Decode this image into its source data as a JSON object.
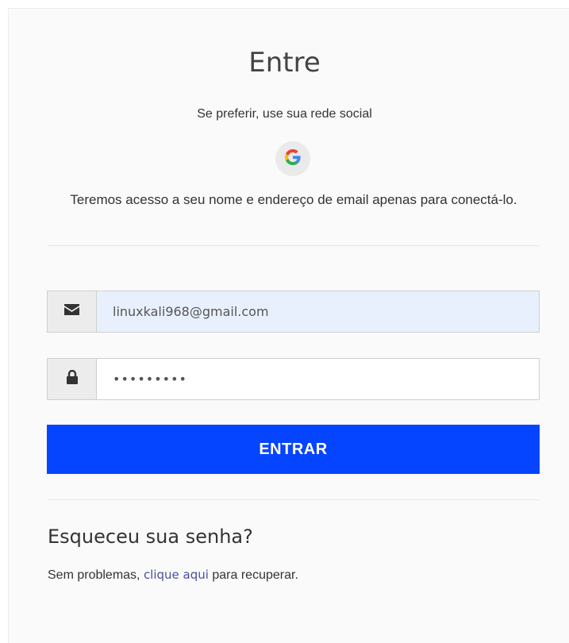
{
  "login": {
    "title": "Entre",
    "social_prompt": "Se preferir, use sua rede social",
    "privacy_note": "Teremos acesso a seu nome e endereço de email apenas para conectá-lo.",
    "email_value": "linuxkali968@gmail.com",
    "password_value": "•••••••••",
    "submit_label": "ENTRAR"
  },
  "forgot": {
    "title": "Esqueceu sua senha?",
    "text_before": "Sem problemas, ",
    "link_label": "clique aqui",
    "text_after": " para recuperar."
  },
  "icons": {
    "google": "google-icon",
    "email": "envelope-icon",
    "password": "lock-icon"
  },
  "colors": {
    "accent": "#0645ff",
    "email_autofill_bg": "#e8f0fe",
    "link": "#4d4d9e"
  }
}
